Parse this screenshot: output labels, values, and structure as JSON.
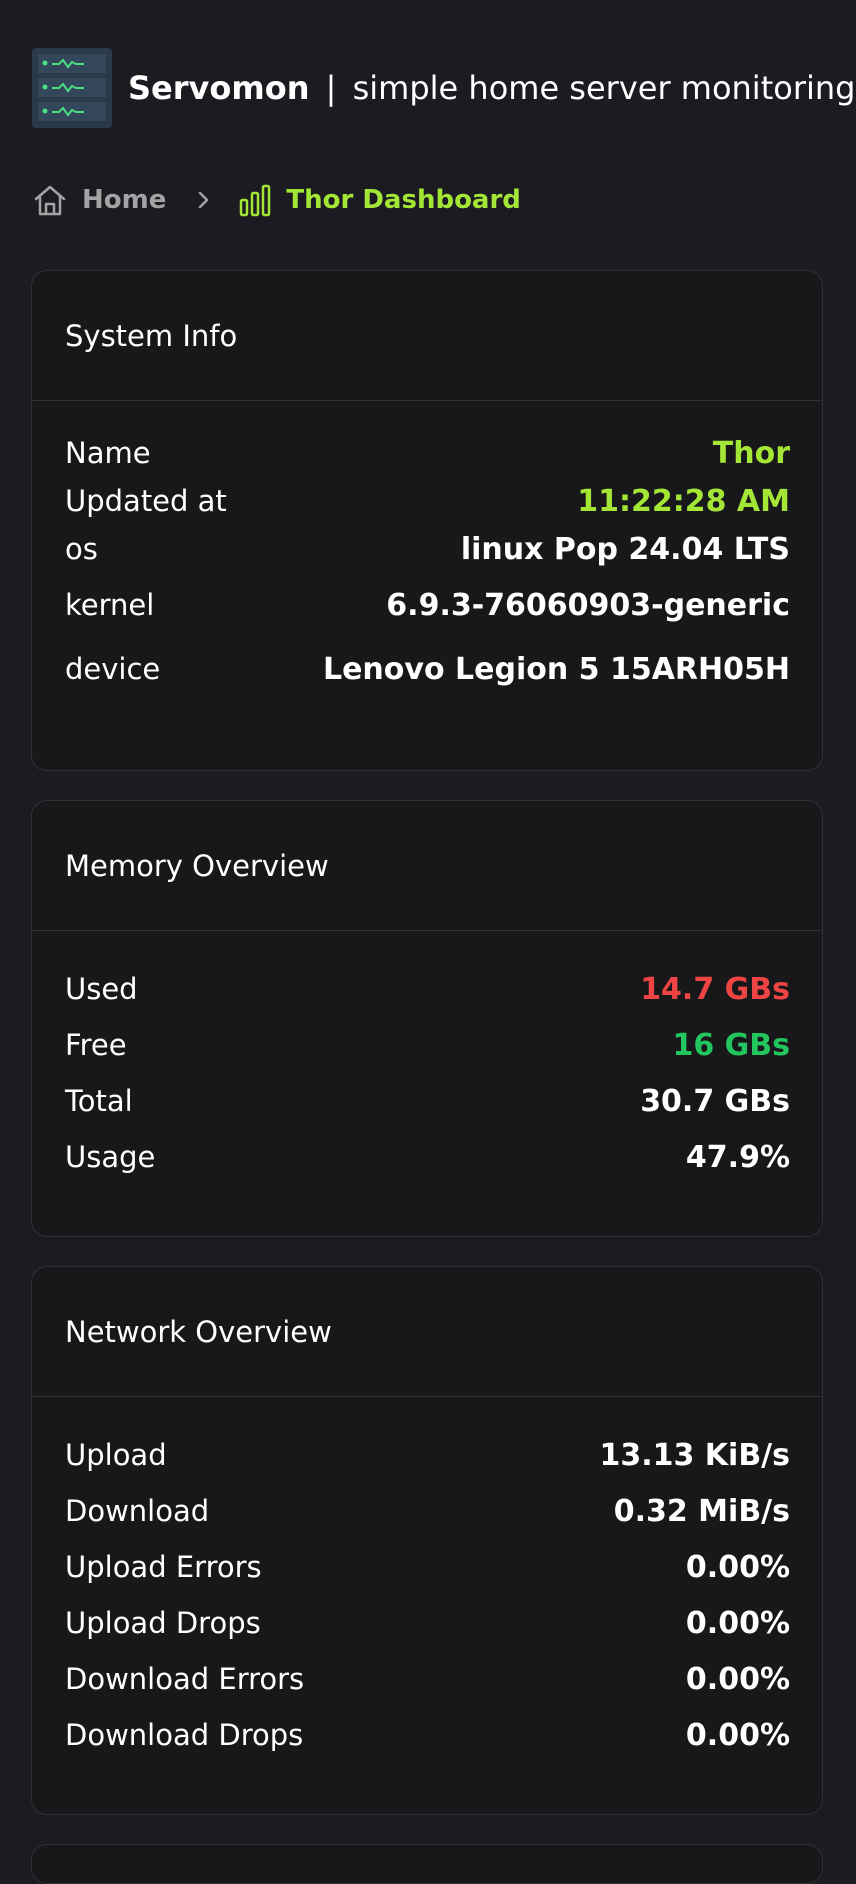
{
  "app": {
    "name": "Servomon",
    "separator": "|",
    "tagline": "simple home server monitoring"
  },
  "breadcrumb": {
    "home": "Home",
    "current": "Thor Dashboard"
  },
  "system_info": {
    "title": "System Info",
    "rows": [
      {
        "label": "Name",
        "value": "Thor"
      },
      {
        "label": "Updated at",
        "value": "11:22:28 AM"
      },
      {
        "label": "os",
        "value": "linux Pop 24.04 LTS"
      },
      {
        "label": "kernel",
        "value": "6.9.3-76060903-generic"
      },
      {
        "label": "device",
        "value": "Lenovo Legion 5 15ARH05H"
      }
    ]
  },
  "memory": {
    "title": "Memory Overview",
    "rows": [
      {
        "label": "Used",
        "value": "14.7 GBs"
      },
      {
        "label": "Free",
        "value": "16 GBs"
      },
      {
        "label": "Total",
        "value": "30.7 GBs"
      },
      {
        "label": "Usage",
        "value": "47.9%"
      }
    ]
  },
  "network": {
    "title": "Network Overview",
    "rows": [
      {
        "label": "Upload",
        "value": "13.13 KiB/s"
      },
      {
        "label": "Download",
        "value": "0.32 MiB/s"
      },
      {
        "label": "Upload Errors",
        "value": "0.00%"
      },
      {
        "label": "Upload Drops",
        "value": "0.00%"
      },
      {
        "label": "Download Errors",
        "value": "0.00%"
      },
      {
        "label": "Download Drops",
        "value": "0.00%"
      }
    ]
  },
  "colors": {
    "background": "#1c1b22",
    "card": "#18181a",
    "accent": "#a3e635",
    "used": "#ef4444",
    "free": "#22c55e"
  },
  "icons": {
    "logo": "server-rack-icon",
    "home": "home-icon",
    "chevron": "chevron-right-icon",
    "dashboard": "bar-chart-icon"
  }
}
